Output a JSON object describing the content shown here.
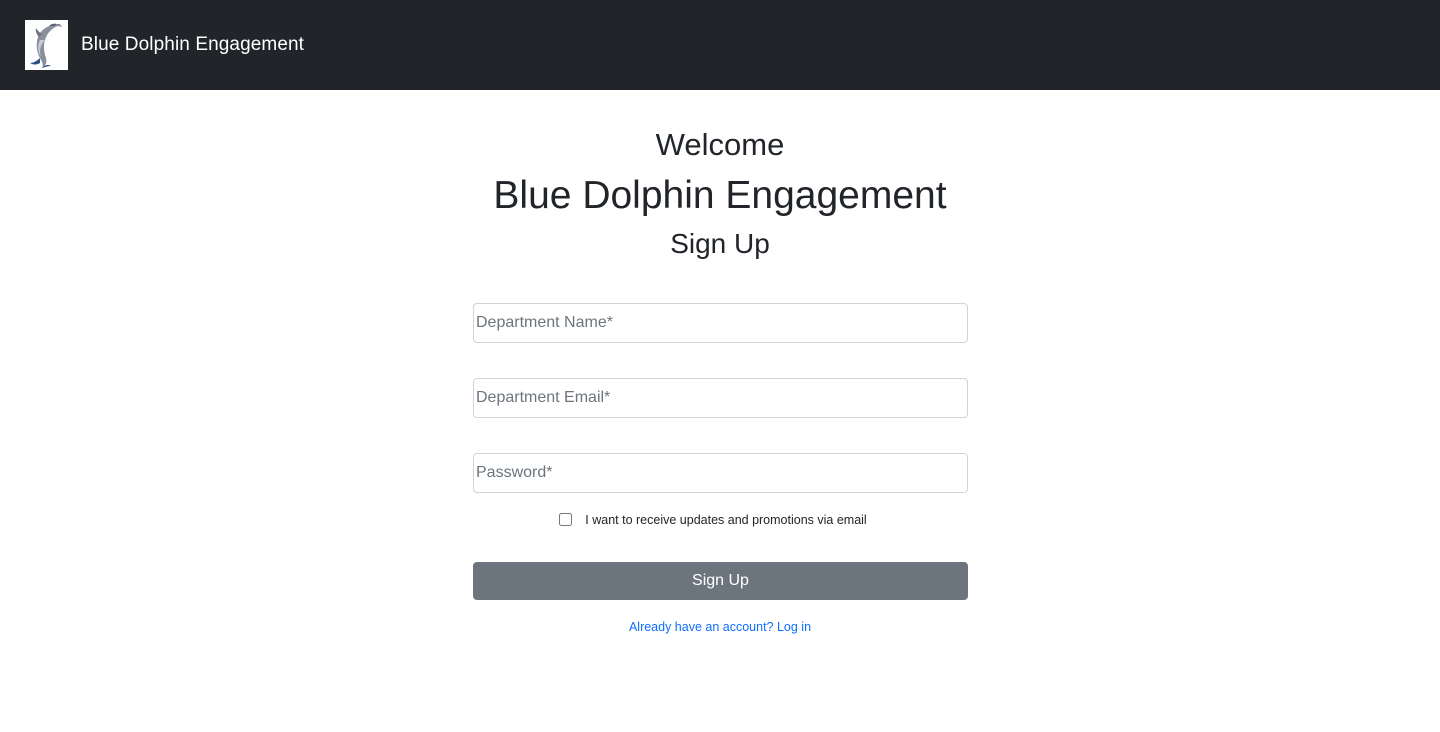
{
  "navbar": {
    "brand_text": "Blue Dolphin Engagement",
    "logo_icon": "dolphin-logo-icon",
    "background_color": "#212529"
  },
  "header": {
    "welcome": "Welcome",
    "app_name": "Blue Dolphin Engagement",
    "form_title": "Sign Up"
  },
  "form": {
    "department_name_placeholder": "Department Name*",
    "department_email_placeholder": "Department Email*",
    "password_placeholder": "Password*",
    "updates_checkbox_label": "I want to receive updates and promotions via email",
    "updates_checked": false,
    "submit_label": "Sign Up",
    "submit_color": "#6c757d"
  },
  "footer": {
    "login_link_text": "Already have an account? Log in",
    "link_color": "#0d6efd"
  }
}
